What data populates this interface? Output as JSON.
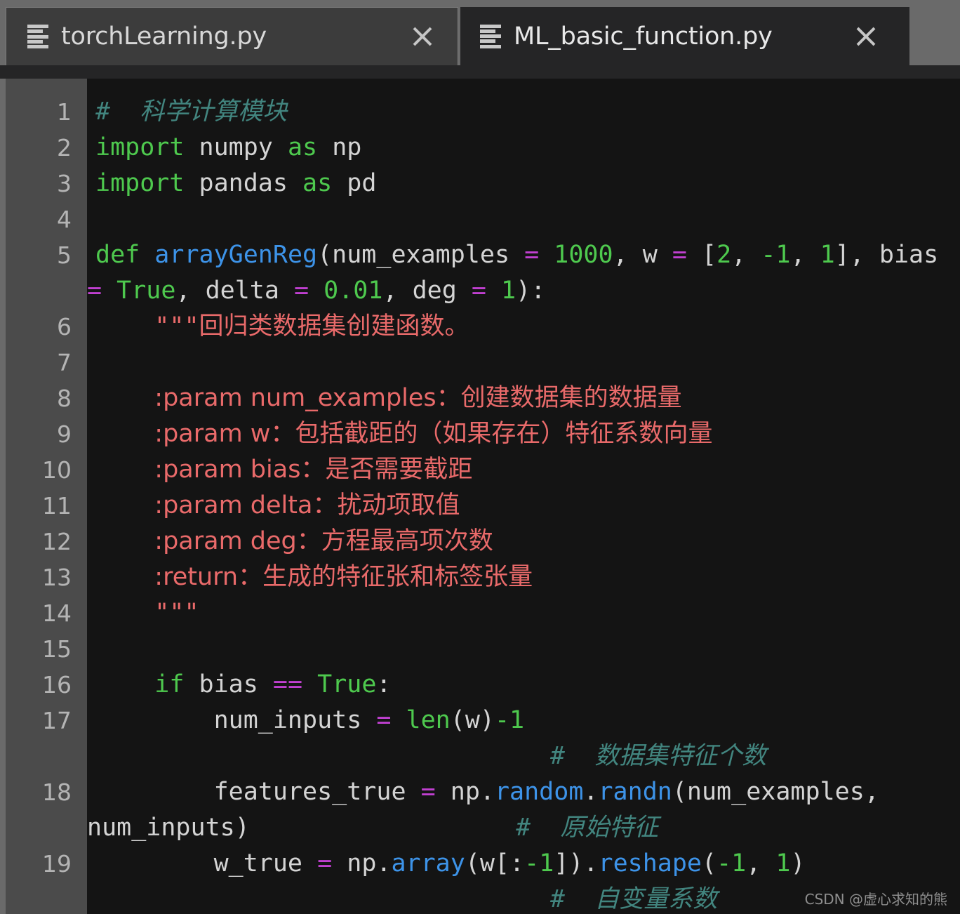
{
  "tabs": [
    {
      "label": "torchLearning.py",
      "active": false,
      "icon": "document-lines-icon",
      "close": "×"
    },
    {
      "label": "ML_basic_function.py",
      "active": true,
      "icon": "document-lines-icon",
      "close": "×"
    }
  ],
  "editor": {
    "language": "python",
    "gutter_line_numbers": [
      "1",
      "2",
      "3",
      "4",
      "5",
      "6",
      "7",
      "8",
      "9",
      "10",
      "11",
      "12",
      "13",
      "14",
      "15",
      "16",
      "17",
      "18",
      "19"
    ],
    "lines": [
      {
        "n": "1",
        "text": "# 科学计算模块"
      },
      {
        "n": "2",
        "text": "import numpy as np"
      },
      {
        "n": "3",
        "text": "import pandas as pd"
      },
      {
        "n": "4",
        "text": ""
      },
      {
        "n": "5",
        "text": "def arrayGenReg(num_examples = 1000, w = [2, -1, 1], bias = True, delta = 0.01, deg = 1):"
      },
      {
        "n": "6",
        "text": "    \"\"\"回归类数据集创建函数。"
      },
      {
        "n": "7",
        "text": ""
      },
      {
        "n": "8",
        "text": "    :param num_examples：创建数据集的数据量"
      },
      {
        "n": "9",
        "text": "    :param w：包括截距的（如果存在）特征系数向量"
      },
      {
        "n": "10",
        "text": "    :param bias：是否需要截距"
      },
      {
        "n": "11",
        "text": "    :param delta：扰动项取值"
      },
      {
        "n": "12",
        "text": "    :param deg：方程最高项次数"
      },
      {
        "n": "13",
        "text": "    :return：生成的特征张和标签张量"
      },
      {
        "n": "14",
        "text": "    \"\"\""
      },
      {
        "n": "15",
        "text": ""
      },
      {
        "n": "16",
        "text": "    if bias == True:"
      },
      {
        "n": "17",
        "text": "        num_inputs = len(w)-1                         # 数据集特征个数"
      },
      {
        "n": "18",
        "text": "        features_true = np.random.randn(num_examples, num_inputs)            # 原始特征"
      },
      {
        "n": "19",
        "text": "        w_true = np.array(w[:-1]).reshape(-1, 1)               # 自变量系数"
      }
    ],
    "tokens": {
      "line1_hash": "#",
      "line1_comment": "科学计算模块",
      "line2_import": "import",
      "line2_mod": "numpy",
      "line2_as": "as",
      "line2_alias": "np",
      "line3_import": "import",
      "line3_mod": "pandas",
      "line3_as": "as",
      "line3_alias": "pd",
      "line5_def": "def",
      "line5_name": "arrayGenReg",
      "line5_open": "(num_examples ",
      "line5_eq1": "=",
      "line5_v1": " 1000",
      "line5_sep1": ", w ",
      "line5_eq2": "=",
      "line5_br1": " [",
      "line5_a": "2",
      "line5_c1": ", ",
      "line5_b": "-1",
      "line5_c2": ", ",
      "line5_c": "1",
      "line5_br2": "], bias",
      "line5b_eq3": "=",
      "line5b_true": " True",
      "line5b_mid": ", delta ",
      "line5b_eq4": "=",
      "line5b_delta": " 0.01",
      "line5b_mid2": ", deg ",
      "line5b_eq5": "=",
      "line5b_deg": " 1",
      "line5b_close": "):",
      "line6_quote": "\"\"\"",
      "line6_text": "回归类数据集创建函数。",
      "line8_text": ":param num_examples：创建数据集的数据量",
      "line9_text": ":param w：包括截距的（如果存在）特征系数向量",
      "line10_text": ":param bias：是否需要截距",
      "line11_text": ":param delta：扰动项取值",
      "line12_text": ":param deg：方程最高项次数",
      "line13_text": ":return：生成的特征张和标签张量",
      "line14_quote": "\"\"\"",
      "line16_if": "if",
      "line16_bias": " bias ",
      "line16_eqeq": "==",
      "line16_true": " True",
      "line16_colon": ":",
      "line17_var": "num_inputs ",
      "line17_eq": "=",
      "line17_len": " len",
      "line17_paren": "(w)",
      "line17_num": "-1",
      "line17_hash": "#",
      "line17_comment": "数据集特征个数",
      "line18_var": "features_true ",
      "line18_eq": "=",
      "line18_np": " np.",
      "line18_random": "random",
      "line18_dot": ".",
      "line18_randn": "randn",
      "line18_args": "(num_examples,",
      "line18b_args": "num_inputs)",
      "line18_hash": "#",
      "line18_comment": "原始特征",
      "line19_var": "w_true ",
      "line19_eq": "=",
      "line19_np": " np.",
      "line19_array": "array",
      "line19_p1": "(w[:",
      "line19_m1": "-1",
      "line19_p2": "]).",
      "line19_reshape": "reshape",
      "line19_p3": "(",
      "line19_m2": "-1",
      "line19_c": ", ",
      "line19_one": "1",
      "line19_p4": ")",
      "line19_hash": "#",
      "line19_comment": "自变量系数"
    }
  },
  "watermark": {
    "text": "CSDN @虚心求知的熊"
  },
  "colors": {
    "tabbar_bg": "#6a6a6a",
    "tab_inactive_bg": "#3c3c3c",
    "tab_active_bg": "#252526",
    "editor_bg": "#141414",
    "gutter_bg": "#4b4b4b",
    "line_number": "#b4b4b4",
    "keyword": "#4ec94e",
    "function": "#3d93e8",
    "operator": "#c040d0",
    "number": "#4ec94e",
    "comment": "#42857f",
    "docstring": "#e96a6a",
    "plain_text": "#d4d4d4"
  }
}
